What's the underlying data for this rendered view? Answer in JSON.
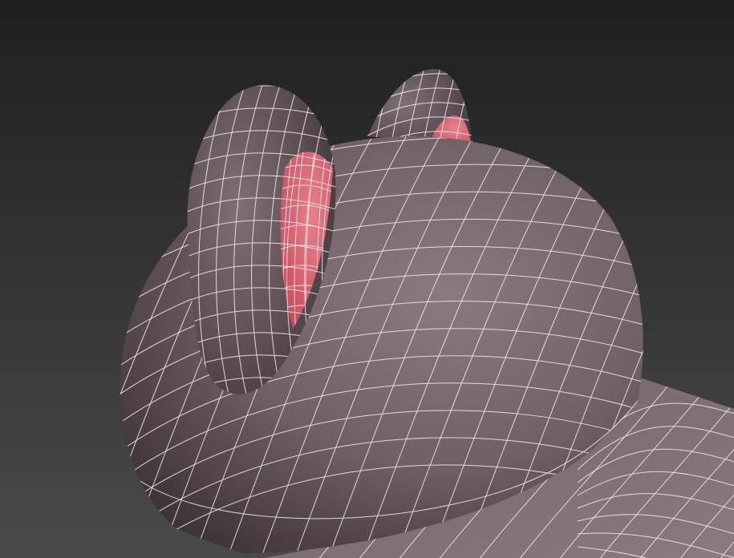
{
  "viewport": {
    "background_top": "#1f1f1f",
    "background_bottom": "#4a4a4a",
    "wireframe_color": "#eee8ee",
    "model": {
      "base_color": "#6f6166",
      "inner_ear_color": "#d9606a",
      "parts": [
        "cap-dome-mesh",
        "cap-brim-mesh",
        "left-ear-mesh",
        "right-ear-mesh"
      ]
    }
  }
}
